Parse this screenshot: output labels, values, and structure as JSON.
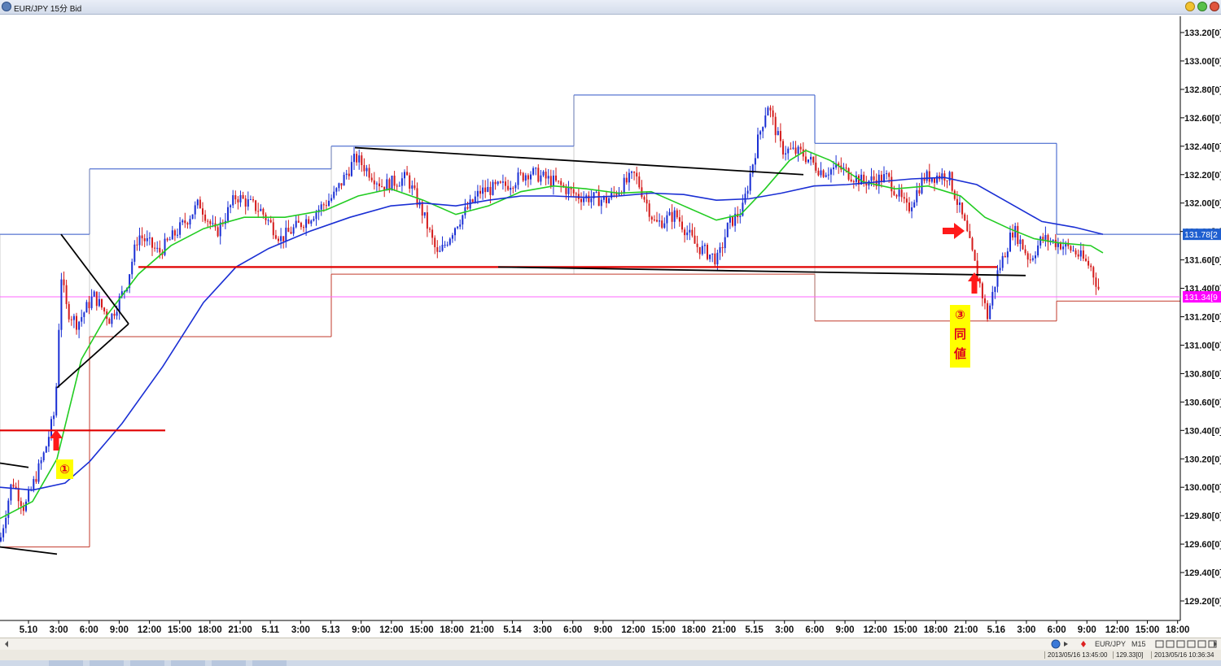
{
  "window": {
    "title": "EUR/JPY 15分 Bid"
  },
  "chart_data": {
    "type": "candlestick",
    "symbol": "EUR/JPY",
    "timeframe": "15分",
    "price_type": "Bid",
    "ylim": [
      129.1,
      133.3
    ],
    "y_ticks": [
      "133.20[0]",
      "133.00[0]",
      "132.80[0]",
      "132.60[0]",
      "132.40[0]",
      "132.20[0]",
      "132.00[0]",
      "131.80[0]",
      "131.60[0]",
      "131.40[0]",
      "131.20[0]",
      "131.00[0]",
      "130.80[0]",
      "130.60[0]",
      "130.40[0]",
      "130.20[0]",
      "130.00[0]",
      "129.80[0]",
      "129.60[0]",
      "129.40[0]",
      "129.20[0]"
    ],
    "y_tick_values": [
      133.2,
      133.0,
      132.8,
      132.6,
      132.4,
      132.2,
      132.0,
      131.8,
      131.6,
      131.4,
      131.2,
      131.0,
      130.8,
      130.6,
      130.4,
      130.2,
      130.0,
      129.8,
      129.6,
      129.4,
      129.2
    ],
    "x_ticks": [
      "5.10",
      "3:00",
      "6:00",
      "9:00",
      "12:00",
      "15:00",
      "18:00",
      "21:00",
      "5.11",
      "3:00",
      "5.13",
      "9:00",
      "12:00",
      "15:00",
      "18:00",
      "21:00",
      "5.14",
      "3:00",
      "6:00",
      "9:00",
      "12:00",
      "15:00",
      "18:00",
      "21:00",
      "5.15",
      "3:00",
      "6:00",
      "9:00",
      "12:00",
      "15:00",
      "18:00",
      "21:00",
      "5.16",
      "3:00",
      "6:00",
      "9:00",
      "12:00",
      "15:00",
      "18:00"
    ],
    "price_labels": [
      {
        "text": "131.78[2",
        "value": 131.78,
        "color": "#1f5fd0"
      },
      {
        "text": "131.34[9",
        "value": 131.34,
        "color": "#ff00ff"
      }
    ],
    "close_path": [
      [
        0,
        129.62
      ],
      [
        15,
        130.05
      ],
      [
        30,
        129.85
      ],
      [
        55,
        130.25
      ],
      [
        68,
        130.55
      ],
      [
        75,
        131.5
      ],
      [
        82,
        131.25
      ],
      [
        95,
        131.15
      ],
      [
        115,
        131.35
      ],
      [
        135,
        131.18
      ],
      [
        155,
        131.42
      ],
      [
        170,
        131.78
      ],
      [
        195,
        131.65
      ],
      [
        225,
        131.85
      ],
      [
        245,
        132.0
      ],
      [
        265,
        131.78
      ],
      [
        290,
        132.05
      ],
      [
        320,
        131.95
      ],
      [
        345,
        131.75
      ],
      [
        380,
        131.9
      ],
      [
        410,
        132.05
      ],
      [
        437,
        132.32
      ],
      [
        470,
        132.12
      ],
      [
        500,
        132.18
      ],
      [
        520,
        131.92
      ],
      [
        538,
        131.62
      ],
      [
        560,
        131.85
      ],
      [
        590,
        132.08
      ],
      [
        620,
        132.12
      ],
      [
        650,
        132.22
      ],
      [
        680,
        132.15
      ],
      [
        710,
        132.05
      ],
      [
        745,
        132.02
      ],
      [
        780,
        132.2
      ],
      [
        805,
        131.85
      ],
      [
        830,
        131.92
      ],
      [
        855,
        131.7
      ],
      [
        882,
        131.6
      ],
      [
        895,
        131.85
      ],
      [
        912,
        131.95
      ],
      [
        930,
        132.42
      ],
      [
        943,
        132.7
      ],
      [
        960,
        132.38
      ],
      [
        985,
        132.35
      ],
      [
        1010,
        132.22
      ],
      [
        1030,
        132.25
      ],
      [
        1060,
        132.15
      ],
      [
        1090,
        132.18
      ],
      [
        1115,
        131.95
      ],
      [
        1135,
        132.18
      ],
      [
        1165,
        132.2
      ],
      [
        1185,
        131.85
      ],
      [
        1205,
        131.4
      ],
      [
        1213,
        131.2
      ],
      [
        1225,
        131.5
      ],
      [
        1245,
        131.82
      ],
      [
        1265,
        131.6
      ],
      [
        1280,
        131.75
      ],
      [
        1300,
        131.72
      ],
      [
        1320,
        131.66
      ],
      [
        1340,
        131.55
      ],
      [
        1352,
        131.36
      ]
    ],
    "series": [
      {
        "name": "",
        "color": "#22cc22",
        "points": [
          [
            0,
            129.78
          ],
          [
            40,
            129.9
          ],
          [
            70,
            130.2
          ],
          [
            100,
            130.9
          ],
          [
            130,
            131.2
          ],
          [
            170,
            131.5
          ],
          [
            210,
            131.7
          ],
          [
            250,
            131.82
          ],
          [
            300,
            131.9
          ],
          [
            350,
            131.9
          ],
          [
            400,
            131.95
          ],
          [
            440,
            132.05
          ],
          [
            480,
            132.1
          ],
          [
            520,
            132.02
          ],
          [
            560,
            131.92
          ],
          [
            600,
            131.98
          ],
          [
            640,
            132.08
          ],
          [
            680,
            132.12
          ],
          [
            720,
            132.1
          ],
          [
            760,
            132.07
          ],
          [
            800,
            132.08
          ],
          [
            840,
            131.98
          ],
          [
            880,
            131.88
          ],
          [
            910,
            131.92
          ],
          [
            940,
            132.1
          ],
          [
            970,
            132.3
          ],
          [
            990,
            132.37
          ],
          [
            1020,
            132.3
          ],
          [
            1060,
            132.15
          ],
          [
            1100,
            132.1
          ],
          [
            1140,
            132.12
          ],
          [
            1180,
            132.05
          ],
          [
            1210,
            131.9
          ],
          [
            1240,
            131.82
          ],
          [
            1270,
            131.75
          ],
          [
            1300,
            131.72
          ],
          [
            1340,
            131.7
          ],
          [
            1355,
            131.65
          ]
        ]
      },
      {
        "name": "",
        "color": "#1a2fd4",
        "points": [
          [
            0,
            130.0
          ],
          [
            40,
            129.98
          ],
          [
            80,
            130.03
          ],
          [
            110,
            130.18
          ],
          [
            150,
            130.45
          ],
          [
            200,
            130.85
          ],
          [
            250,
            131.3
          ],
          [
            290,
            131.55
          ],
          [
            330,
            131.68
          ],
          [
            380,
            131.8
          ],
          [
            430,
            131.9
          ],
          [
            480,
            131.98
          ],
          [
            520,
            132.0
          ],
          [
            560,
            131.98
          ],
          [
            600,
            132.02
          ],
          [
            640,
            132.05
          ],
          [
            680,
            132.05
          ],
          [
            720,
            132.04
          ],
          [
            760,
            132.05
          ],
          [
            800,
            132.07
          ],
          [
            840,
            132.06
          ],
          [
            880,
            132.02
          ],
          [
            920,
            132.03
          ],
          [
            960,
            132.07
          ],
          [
            1000,
            132.12
          ],
          [
            1040,
            132.13
          ],
          [
            1080,
            132.15
          ],
          [
            1120,
            132.17
          ],
          [
            1160,
            132.18
          ],
          [
            1200,
            132.13
          ],
          [
            1240,
            132.0
          ],
          [
            1280,
            131.87
          ],
          [
            1320,
            131.83
          ],
          [
            1355,
            131.78
          ]
        ]
      }
    ],
    "boxes": [
      {
        "x1": 0,
        "x2": 110,
        "hi": 131.78,
        "lo": 129.58
      },
      {
        "x1": 110,
        "x2": 407,
        "hi": 132.24,
        "lo": 131.06
      },
      {
        "x1": 407,
        "x2": 705,
        "hi": 132.4,
        "lo": 131.5
      },
      {
        "x1": 705,
        "x2": 1001,
        "hi": 132.76,
        "lo": 131.5
      },
      {
        "x1": 1001,
        "x2": 1298,
        "hi": 132.42,
        "lo": 131.17
      },
      {
        "x1": 1298,
        "x2": 1450,
        "hi": 131.78,
        "lo": 131.31
      }
    ],
    "horizontal_lines": [
      {
        "value": 131.34,
        "color": "#ff66ff",
        "x1": 0,
        "x2": 1450
      }
    ],
    "red_lines": [
      {
        "x1": 0,
        "y1": 130.4,
        "x2": 203,
        "y2": 130.4
      },
      {
        "x1": 170,
        "y1": 131.55,
        "x2": 1225,
        "y2": 131.55
      }
    ],
    "black_lines": [
      {
        "x1": 436,
        "y1": 132.39,
        "x2": 987,
        "y2": 132.2
      },
      {
        "x1": 612,
        "y1": 131.55,
        "x2": 1260,
        "y2": 131.49
      },
      {
        "x1": 75,
        "y1": 131.78,
        "x2": 158,
        "y2": 131.15
      },
      {
        "x1": 70,
        "y1": 130.7,
        "x2": 158,
        "y2": 131.15
      },
      {
        "x1": 0,
        "y1": 129.58,
        "x2": 70,
        "y2": 129.53
      },
      {
        "x1": 0,
        "y1": 130.17,
        "x2": 35,
        "y2": 130.14
      }
    ],
    "annotations": [
      {
        "label": "①"
      },
      {
        "label": "③"
      },
      {
        "label": "同"
      },
      {
        "label": "値"
      }
    ]
  },
  "statusbar": {
    "symbol": "EUR/JPY",
    "timeframe": "M15",
    "cell1": "2013/05/16 13:45:00",
    "cell2": "129.33[0]",
    "cell3": "2013/05/16 10:36:34"
  }
}
